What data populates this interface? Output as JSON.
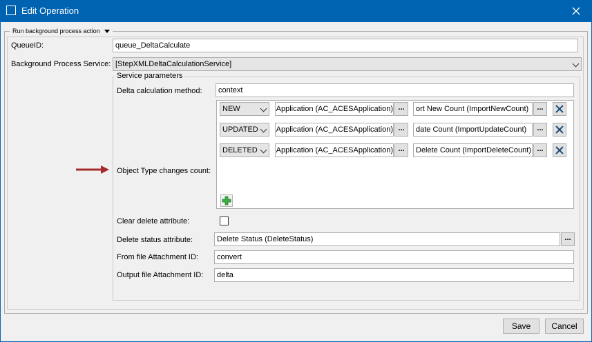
{
  "window": {
    "title": "Edit Operation",
    "close_icon": "close-icon",
    "app_icon": "window-icon"
  },
  "section": {
    "header_label": "Run background process action",
    "toggle_icon": "triangle-down-icon"
  },
  "form": {
    "queue_id_label": "QueueID:",
    "queue_id_value": "queue_DeltaCalculate",
    "bg_service_label": "Background Process Service:",
    "bg_service_value": "[StepXMLDeltaCalculationService]",
    "service_params_legend": "Service parameters",
    "delta_method_label": "Delta calculation method:",
    "delta_method_value": "context",
    "obj_type_label": "Object Type changes count:",
    "rows": [
      {
        "type": "NEW",
        "object": "Application (AC_ACESApplication)",
        "attribute": "ort New Count (ImportNewCount)"
      },
      {
        "type": "UPDATED",
        "object": "Application (AC_ACESApplication)",
        "attribute": "date Count (ImportUpdateCount)"
      },
      {
        "type": "DELETED",
        "object": "Application (AC_ACESApplication)",
        "attribute": "Delete Count (ImportDeleteCount)"
      }
    ],
    "browse_label": "...",
    "clear_delete_label": "Clear delete attribute:",
    "clear_delete_checked": false,
    "delete_status_label": "Delete status attribute:",
    "delete_status_value": "Delete Status (DeleteStatus)",
    "from_file_label": "From file Attachment ID:",
    "from_file_value": "convert",
    "output_file_label": "Output file Attachment ID:",
    "output_file_value": "delta"
  },
  "footer": {
    "save_label": "Save",
    "cancel_label": "Cancel"
  },
  "colors": {
    "titlebar": "#0063b1",
    "arrow": "#a52a2a",
    "add_icon": "#3cb043",
    "delete_icon": "#1f4e79"
  }
}
